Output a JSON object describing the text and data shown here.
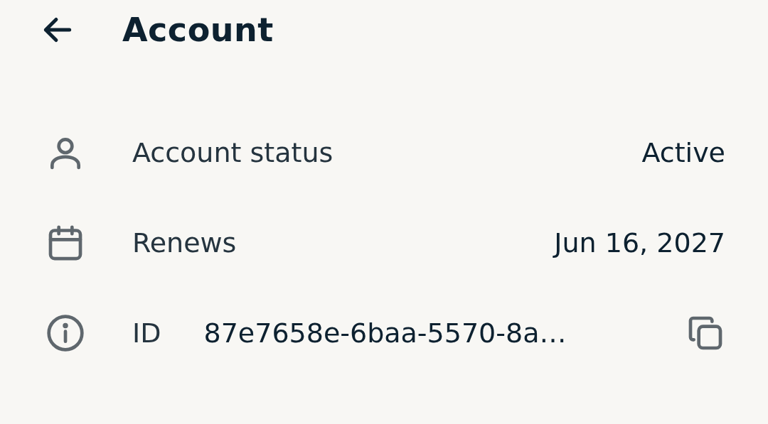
{
  "header": {
    "title": "Account"
  },
  "rows": [
    {
      "kind": "status",
      "label": "Account status",
      "value": "Active"
    },
    {
      "kind": "renews",
      "label": "Renews",
      "value": "Jun 16, 2027"
    },
    {
      "kind": "id",
      "label": "ID",
      "value": "87e7658e-6baa-5570-8a…"
    }
  ]
}
